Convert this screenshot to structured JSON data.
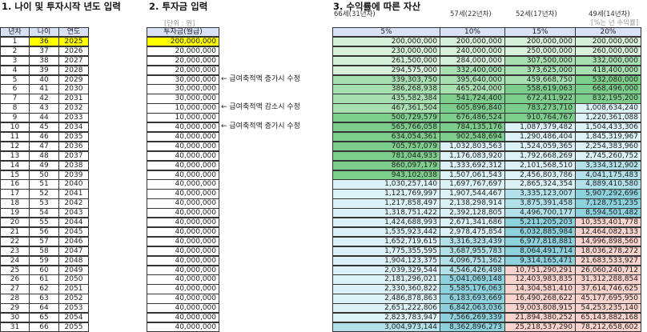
{
  "titles": {
    "section1": "1. 나이 및 투자시작 년도 입력",
    "section2": "2. 투자금 입력",
    "section3": "3. 수익률에 따른 자산"
  },
  "unit_label": "[단위 : 원]",
  "rate_hint": "[%는 년 수익률]",
  "milestones": [
    "66세(31년차)",
    "57세(22년차)",
    "52세(17년차)",
    "49세(14년차)"
  ],
  "left_table": {
    "headers": [
      "년차",
      "나이",
      "연도"
    ],
    "rows": [
      [
        "1",
        "36",
        "2025"
      ],
      [
        "2",
        "37",
        "2026"
      ],
      [
        "3",
        "38",
        "2027"
      ],
      [
        "4",
        "39",
        "2028"
      ],
      [
        "5",
        "40",
        "2029"
      ],
      [
        "6",
        "41",
        "2030"
      ],
      [
        "7",
        "42",
        "2031"
      ],
      [
        "8",
        "43",
        "2032"
      ],
      [
        "9",
        "44",
        "2033"
      ],
      [
        "10",
        "45",
        "2034"
      ],
      [
        "11",
        "46",
        "2035"
      ],
      [
        "12",
        "47",
        "2036"
      ],
      [
        "13",
        "48",
        "2037"
      ],
      [
        "14",
        "49",
        "2038"
      ],
      [
        "15",
        "50",
        "2039"
      ],
      [
        "16",
        "51",
        "2040"
      ],
      [
        "17",
        "52",
        "2041"
      ],
      [
        "18",
        "53",
        "2042"
      ],
      [
        "19",
        "54",
        "2043"
      ],
      [
        "20",
        "55",
        "2044"
      ],
      [
        "21",
        "56",
        "2045"
      ],
      [
        "22",
        "57",
        "2046"
      ],
      [
        "23",
        "58",
        "2047"
      ],
      [
        "24",
        "59",
        "2048"
      ],
      [
        "25",
        "60",
        "2049"
      ],
      [
        "26",
        "61",
        "2050"
      ],
      [
        "27",
        "62",
        "2051"
      ],
      [
        "28",
        "63",
        "2052"
      ],
      [
        "29",
        "64",
        "2053"
      ],
      [
        "30",
        "65",
        "2054"
      ],
      [
        "31",
        "66",
        "2055"
      ]
    ]
  },
  "investment": {
    "header": "투자금(월급)",
    "values": [
      "200,000,000",
      "20,000,000",
      "20,000,000",
      "20,000,000",
      "30,000,000",
      "30,000,000",
      "30,000,000",
      "10,000,000",
      "10,000,000",
      "40,000,000",
      "40,000,000",
      "40,000,000",
      "40,000,000",
      "40,000,000",
      "40,000,000",
      "40,000,000",
      "40,000,000",
      "40,000,000",
      "40,000,000",
      "40,000,000",
      "40,000,000",
      "40,000,000",
      "40,000,000",
      "40,000,000",
      "40,000,000",
      "40,000,000",
      "40,000,000",
      "40,000,000",
      "40,000,000",
      "40,000,000",
      "40,000,000"
    ]
  },
  "notes": [
    {
      "row": 5,
      "text": "← 급여축적액 증가시 수정"
    },
    {
      "row": 8,
      "text": "← 급여축적액 감소시 수정"
    },
    {
      "row": 10,
      "text": "← 급여축적액 증가시 수정"
    }
  ],
  "returns": {
    "headers": [
      "5%",
      "10%",
      "15%",
      "20%"
    ],
    "columns": [
      [
        "200,000,000",
        "230,000,000",
        "261,500,000",
        "294,575,000",
        "339,303,750",
        "386,268,938",
        "435,582,384",
        "467,361,504",
        "500,729,579",
        "565,766,058",
        "634,054,361",
        "705,757,079",
        "781,044,933",
        "860,097,179",
        "943,102,038",
        "1,030,257,140",
        "1,121,769,997",
        "1,217,858,497",
        "1,318,751,422",
        "1,424,688,993",
        "1,535,923,442",
        "1,652,719,615",
        "1,775,355,595",
        "1,904,123,375",
        "2,039,329,544",
        "2,181,296,021",
        "2,330,360,822",
        "2,486,878,863",
        "2,651,222,806",
        "2,823,783,947",
        "3,004,973,144"
      ],
      [
        "200,000,000",
        "240,000,000",
        "284,000,000",
        "332,400,000",
        "395,640,000",
        "465,204,000",
        "541,724,400",
        "605,896,840",
        "676,486,524",
        "784,135,176",
        "902,548,694",
        "1,032,803,563",
        "1,176,083,920",
        "1,333,692,312",
        "1,507,061,543",
        "1,697,767,697",
        "1,907,544,467",
        "2,138,298,914",
        "2,392,128,805",
        "2,671,341,686",
        "2,978,475,854",
        "3,316,323,439",
        "3,687,955,783",
        "4,096,751,362",
        "4,546,426,498",
        "5,041,069,148",
        "5,585,176,063",
        "6,183,693,669",
        "6,842,063,036",
        "7,566,269,339",
        "8,362,896,273"
      ],
      [
        "200,000,000",
        "250,000,000",
        "307,500,000",
        "373,625,000",
        "459,668,750",
        "558,619,063",
        "672,411,922",
        "783,273,710",
        "910,764,767",
        "1,087,379,482",
        "1,290,486,404",
        "1,524,059,365",
        "1,792,668,269",
        "2,101,568,510",
        "2,456,803,786",
        "2,865,324,354",
        "3,335,123,007",
        "3,875,391,458",
        "4,496,700,177",
        "5,211,205,203",
        "6,032,885,984",
        "6,977,818,881",
        "8,064,491,714",
        "9,314,165,471",
        "10,751,290,291",
        "12,403,983,835",
        "14,304,581,410",
        "16,490,268,622",
        "19,003,808,915",
        "21,894,380,252",
        "25,218,537,290"
      ],
      [
        "200,000,000",
        "260,000,000",
        "332,000,000",
        "418,400,000",
        "532,080,000",
        "668,496,000",
        "832,195,200",
        "1,008,634,240",
        "1,220,361,088",
        "1,504,433,306",
        "1,845,319,967",
        "2,254,383,960",
        "2,745,260,752",
        "3,334,312,902",
        "4,041,175,483",
        "4,889,410,580",
        "5,907,292,696",
        "7,128,751,235",
        "8,594,501,482",
        "10,353,401,778",
        "12,464,082,133",
        "14,996,898,560",
        "18,036,278,272",
        "21,683,533,927",
        "26,060,240,712",
        "31,312,288,854",
        "37,614,746,625",
        "45,177,695,950",
        "54,253,235,140",
        "65,143,882,168",
        "78,212,658,602"
      ]
    ]
  },
  "colors": {
    "header_bg": "#d9e1f7",
    "input_highlight": "#ffff00",
    "green_light": "#d6f0d9",
    "green_mid": "#a9e0b2",
    "green_dark": "#7dcd8c",
    "cyan_light": "#ddf2f6",
    "cyan_mid": "#b3e1e9",
    "cyan_dark": "#8dd1dc",
    "pink": "#f8d2cd"
  }
}
